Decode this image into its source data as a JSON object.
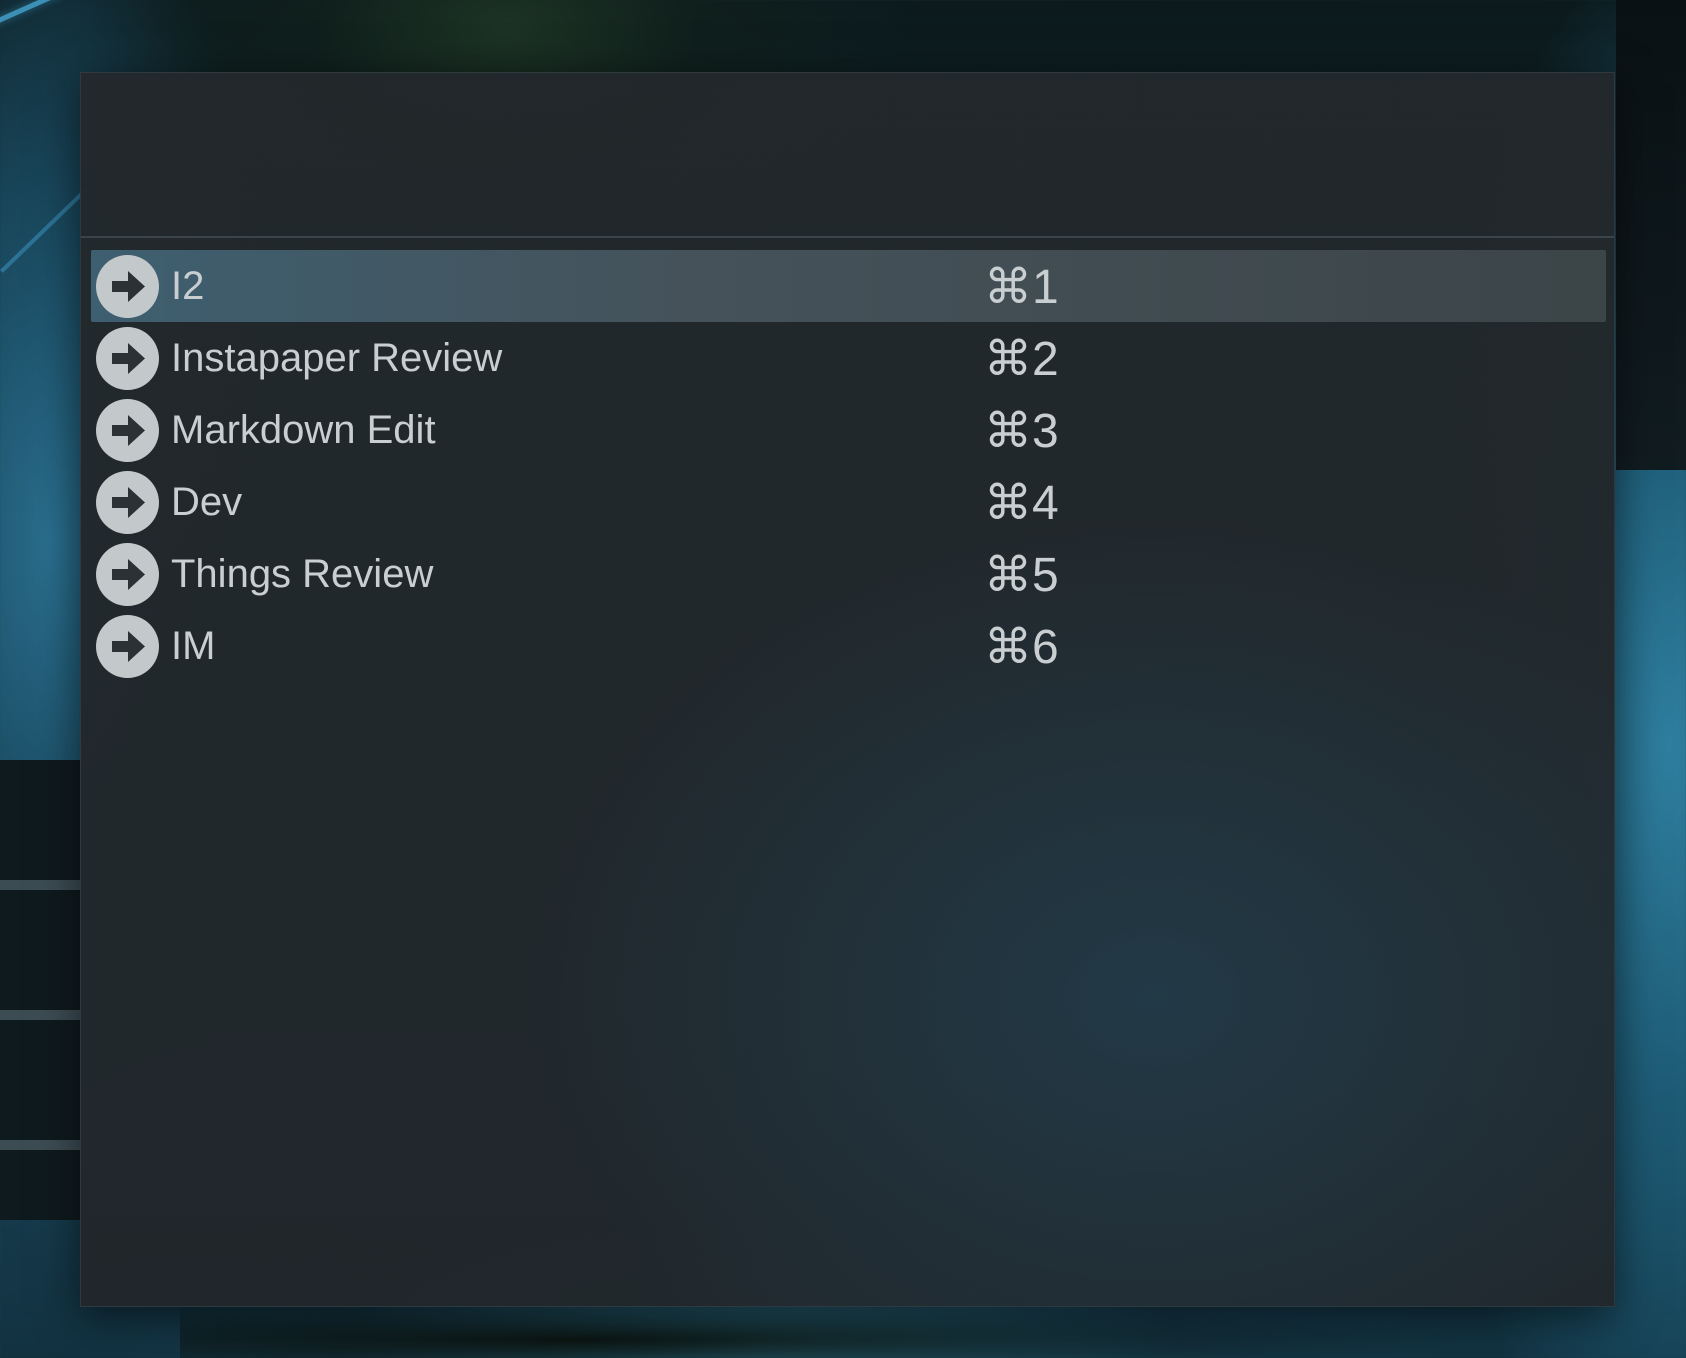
{
  "search": {
    "value": "",
    "placeholder": ""
  },
  "results": [
    {
      "label": "I2",
      "shortcut": "⌘1",
      "icon": "arrow-right-icon",
      "selected": true
    },
    {
      "label": "Instapaper Review",
      "shortcut": "⌘2",
      "icon": "arrow-right-icon",
      "selected": false
    },
    {
      "label": "Markdown Edit",
      "shortcut": "⌘3",
      "icon": "arrow-right-icon",
      "selected": false
    },
    {
      "label": "Dev",
      "shortcut": "⌘4",
      "icon": "arrow-right-icon",
      "selected": false
    },
    {
      "label": "Things Review",
      "shortcut": "⌘5",
      "icon": "arrow-right-icon",
      "selected": false
    },
    {
      "label": "IM",
      "shortcut": "⌘6",
      "icon": "arrow-right-icon",
      "selected": false
    }
  ],
  "colors": {
    "text": "#c9ced1",
    "icon_fill": "#c3c8cb",
    "icon_arrow": "#2b3236",
    "panel_bg": "#22282b",
    "selection": "#45525a"
  }
}
